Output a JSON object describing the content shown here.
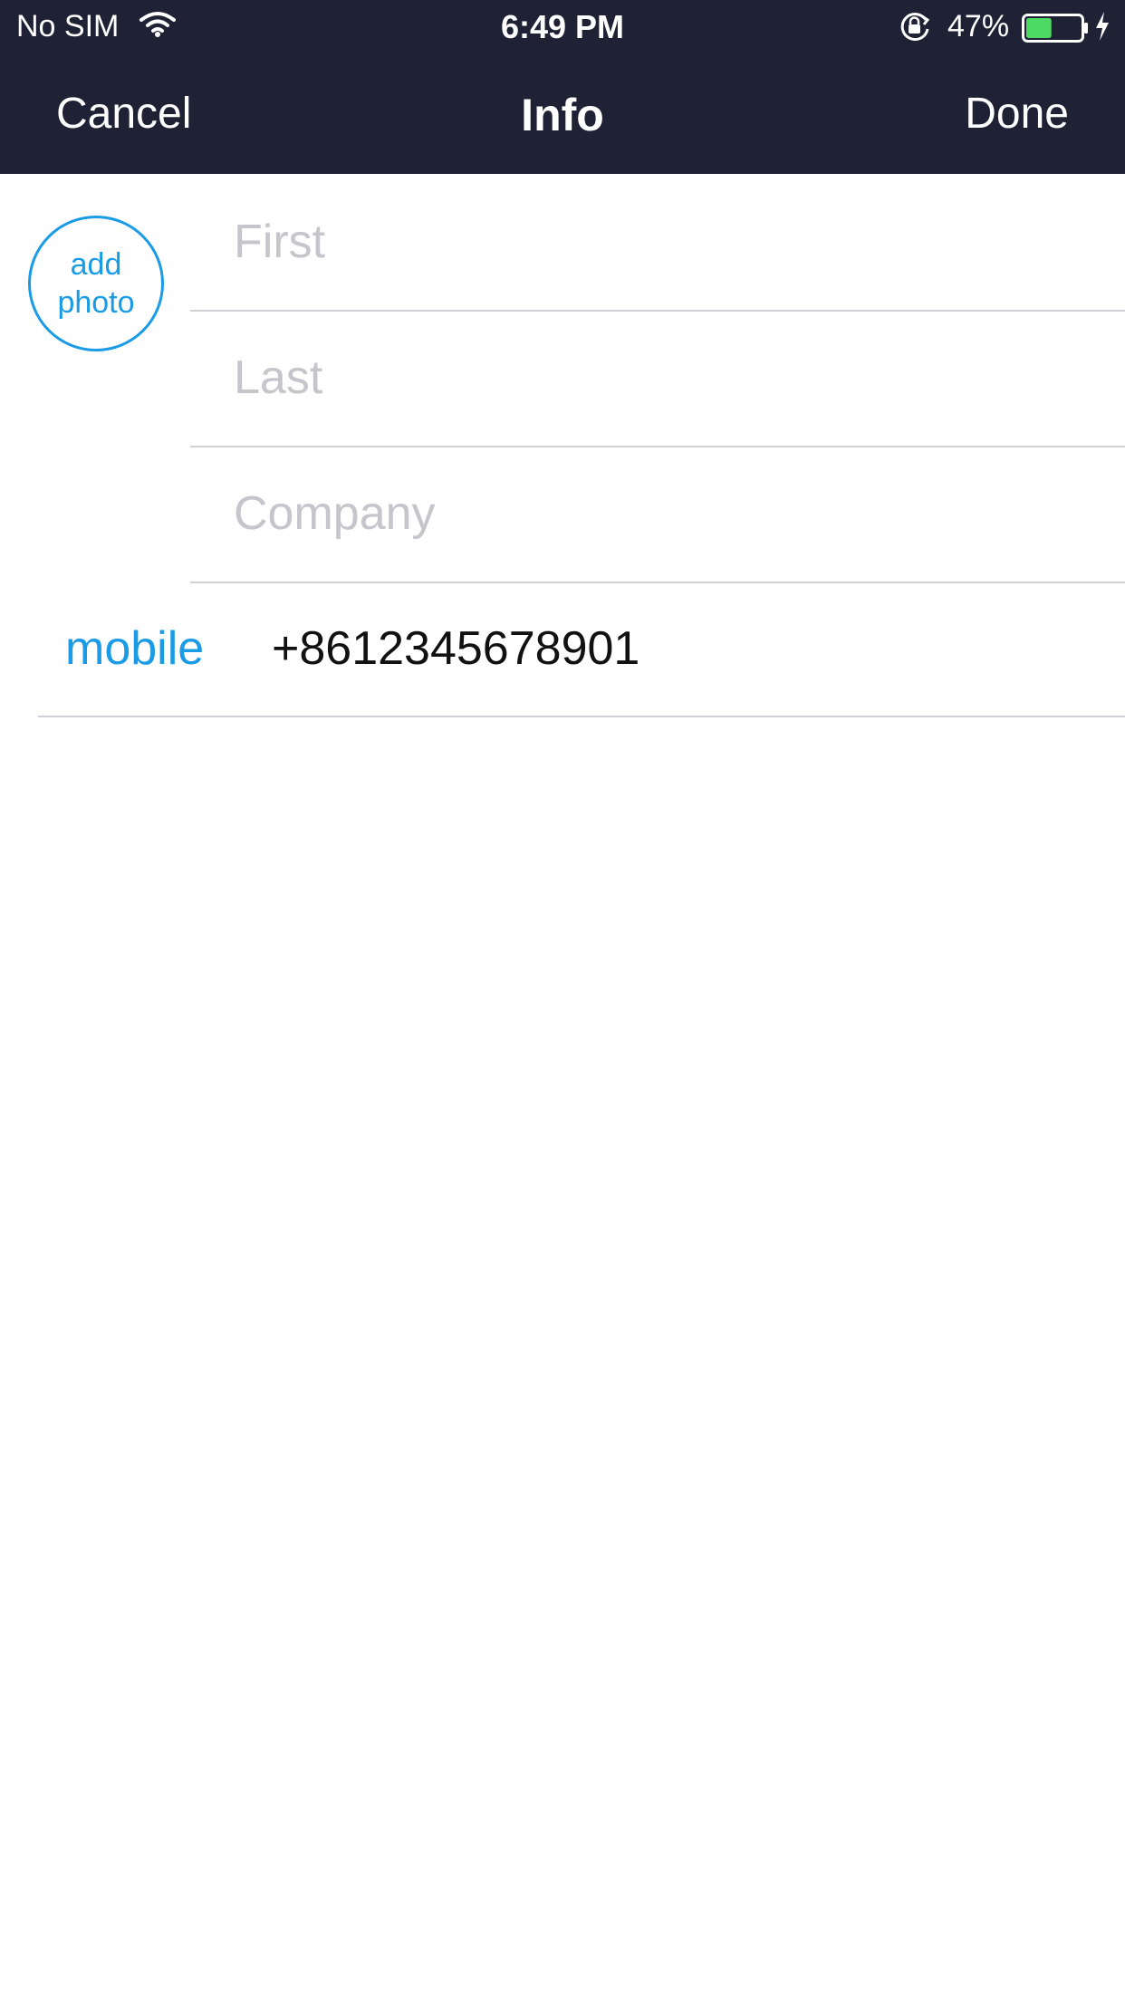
{
  "status_bar": {
    "carrier": "No SIM",
    "time": "6:49 PM",
    "battery_percent": "47%",
    "battery_level": 0.47,
    "icons": [
      "wifi-icon",
      "rotation-lock-icon",
      "battery-icon",
      "charging-bolt-icon"
    ]
  },
  "nav": {
    "cancel_label": "Cancel",
    "title": "Info",
    "done_label": "Done"
  },
  "form": {
    "add_photo_line1": "add",
    "add_photo_line2": "photo",
    "first_placeholder": "First",
    "last_placeholder": "Last",
    "company_placeholder": "Company",
    "phone_label": "mobile",
    "phone_value": "+8612345678901"
  },
  "colors": {
    "nav_background": "#1f2135",
    "accent": "#1a9be6",
    "placeholder": "#c5c5cb",
    "separator": "#d0d0d6",
    "battery_fill": "#4cd964"
  }
}
